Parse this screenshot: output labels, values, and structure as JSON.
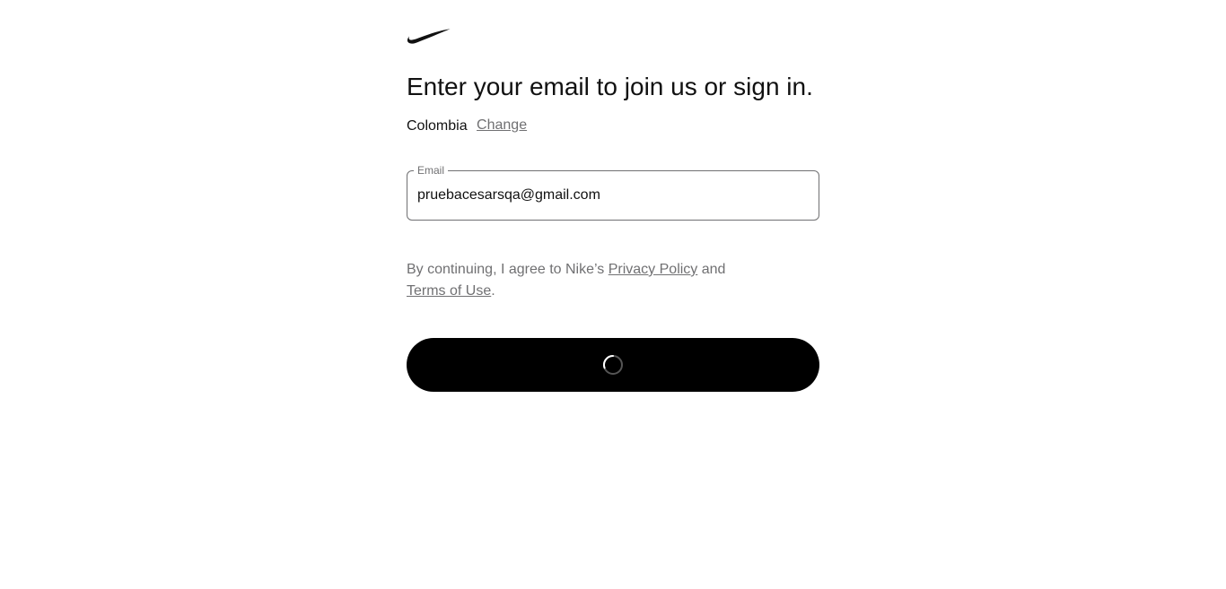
{
  "logo": {
    "icon": "nike-swoosh-icon",
    "color": "#111111"
  },
  "heading": "Enter your email to join us or sign in.",
  "country": {
    "name": "Colombia",
    "change_label": "Change"
  },
  "email_field": {
    "label": "Email",
    "value": "pruebacesarsqa@gmail.com"
  },
  "terms": {
    "prefix": "By continuing, I agree to Nike’s ",
    "privacy_link": "Privacy Policy",
    "middle": " and",
    "terms_link": "Terms of Use",
    "suffix": "."
  },
  "continue_button": {
    "state": "loading",
    "icon": "loading-spinner-icon",
    "background": "#000000"
  }
}
